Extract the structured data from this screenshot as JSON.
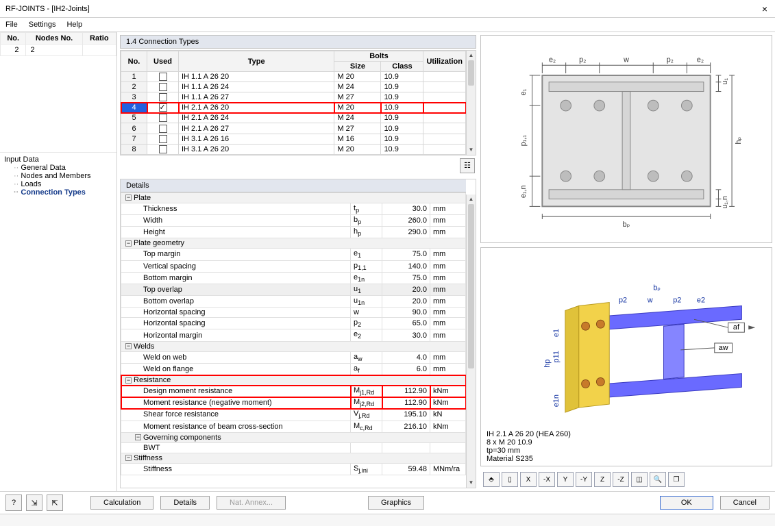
{
  "title": "RF-JOINTS - [IH2-Joints]",
  "menu": [
    "File",
    "Settings",
    "Help"
  ],
  "left_table": {
    "headers": [
      "No.",
      "Nodes No.",
      "Ratio"
    ],
    "row": [
      "2",
      "2",
      ""
    ]
  },
  "tree": {
    "root": "Input Data",
    "items": [
      "General Data",
      "Nodes and Members",
      "Loads",
      "Connection Types"
    ],
    "selected": "Connection Types"
  },
  "section_title": "1.4 Connection Types",
  "conn_headers": {
    "no": "No.",
    "used": "Used",
    "type": "Type",
    "bolts": "Bolts",
    "size": "Size",
    "class": "Class",
    "util": "Utilization"
  },
  "conn_rows": [
    {
      "no": "1",
      "used": false,
      "type": "IH 1.1 A 26 20",
      "size": "M 20",
      "cls": "10.9"
    },
    {
      "no": "2",
      "used": false,
      "type": "IH 1.1 A 26 24",
      "size": "M 24",
      "cls": "10.9"
    },
    {
      "no": "3",
      "used": false,
      "type": "IH 1.1 A 26 27",
      "size": "M 27",
      "cls": "10.9"
    },
    {
      "no": "4",
      "used": true,
      "type": "IH 2.1 A 26 20",
      "size": "M 20",
      "cls": "10.9",
      "sel": true,
      "hl": true
    },
    {
      "no": "5",
      "used": false,
      "type": "IH 2.1 A 26 24",
      "size": "M 24",
      "cls": "10.9"
    },
    {
      "no": "6",
      "used": false,
      "type": "IH 2.1 A 26 27",
      "size": "M 27",
      "cls": "10.9"
    },
    {
      "no": "7",
      "used": false,
      "type": "IH 3.1 A 26 16",
      "size": "M 16",
      "cls": "10.9"
    },
    {
      "no": "8",
      "used": false,
      "type": "IH 3.1 A 26 20",
      "size": "M 20",
      "cls": "10.9"
    }
  ],
  "details_title": "Details",
  "details": [
    {
      "group": true,
      "label": "Plate"
    },
    {
      "label": "Thickness",
      "sym": "t<sub class='sub'>p</sub>",
      "val": "30.0",
      "un": "mm"
    },
    {
      "label": "Width",
      "sym": "b<sub class='sub'>p</sub>",
      "val": "260.0",
      "un": "mm"
    },
    {
      "label": "Height",
      "sym": "h<sub class='sub'>p</sub>",
      "val": "290.0",
      "un": "mm"
    },
    {
      "group": true,
      "label": "Plate geometry"
    },
    {
      "label": "Top margin",
      "sym": "e<sub class='sub'>1</sub>",
      "val": "75.0",
      "un": "mm"
    },
    {
      "label": "Vertical spacing",
      "sym": "p<sub class='sub'>1,1</sub>",
      "val": "140.0",
      "un": "mm"
    },
    {
      "label": "Bottom margin",
      "sym": "e<sub class='sub'>1n</sub>",
      "val": "75.0",
      "un": "mm"
    },
    {
      "label": "Top overlap",
      "sym": "u<sub class='sub'>1</sub>",
      "val": "20.0",
      "un": "mm",
      "shade": true
    },
    {
      "label": "Bottom overlap",
      "sym": "u<sub class='sub'>1n</sub>",
      "val": "20.0",
      "un": "mm"
    },
    {
      "label": "Horizontal spacing",
      "sym": "w",
      "val": "90.0",
      "un": "mm"
    },
    {
      "label": "Horizontal spacing",
      "sym": "p<sub class='sub'>2</sub>",
      "val": "65.0",
      "un": "mm"
    },
    {
      "label": "Horizontal margin",
      "sym": "e<sub class='sub'>2</sub>",
      "val": "30.0",
      "un": "mm"
    },
    {
      "group": true,
      "label": "Welds"
    },
    {
      "label": "Weld on web",
      "sym": "a<sub class='sub'>w</sub>",
      "val": "4.0",
      "un": "mm"
    },
    {
      "label": "Weld on flange",
      "sym": "a<sub class='sub'>f</sub>",
      "val": "6.0",
      "un": "mm"
    },
    {
      "group": true,
      "label": "Resistance",
      "redgroup": true
    },
    {
      "label": "Design moment resistance",
      "sym": "M<sub class='sub'>j1,Rd</sub>",
      "val": "112.90",
      "un": "kNm",
      "red": true
    },
    {
      "label": "Moment resistance (negative moment)",
      "sym": "M<sub class='sub'>j2,Rd</sub>",
      "val": "112.90",
      "un": "kNm",
      "red": true
    },
    {
      "label": "Shear force resistance",
      "sym": "V<sub class='sub'>j,Rd</sub>",
      "val": "195.10",
      "un": "kN"
    },
    {
      "label": "Moment resistance of beam cross-section",
      "sym": "M<sub class='sub'>c,Rd</sub>",
      "val": "216.10",
      "un": "kNm"
    },
    {
      "group2": true,
      "label": "Governing components"
    },
    {
      "label": "BWT",
      "sym": "",
      "val": "",
      "un": ""
    },
    {
      "group": true,
      "label": "Stiffness"
    },
    {
      "label": "Stiffness",
      "sym": "S<sub class='sub'>j,ini</sub>",
      "val": "59.48",
      "un": "MNm/ra"
    }
  ],
  "info_lines": [
    "IH 2.1 A 26 20  (HEA 260)",
    "8 x M 20 10.9",
    "tp=30 mm",
    "Material S235"
  ],
  "diagram_labels": {
    "e2": "e₂",
    "p2": "p₂",
    "w": "w",
    "e1": "e₁",
    "p11": "p₁,₁",
    "e1n": "e₁,n",
    "u1": "u₁",
    "u1n": "u₁,n",
    "hp": "hₚ",
    "bp": "bₚ",
    "af": "af",
    "aw": "aw",
    "p2s": "p2",
    "e2s": "e2"
  },
  "buttons": {
    "calc": "Calculation",
    "details": "Details",
    "annex": "Nat. Annex...",
    "graphics": "Graphics",
    "ok": "OK",
    "cancel": "Cancel"
  }
}
